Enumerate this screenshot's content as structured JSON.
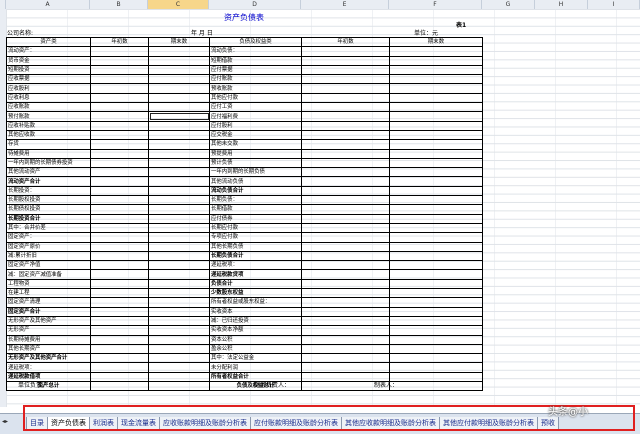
{
  "columns": [
    "A",
    "B",
    "C",
    "D",
    "E",
    "F",
    "G",
    "H",
    "I"
  ],
  "title": "资产负债表",
  "sheet_no": "表1",
  "company_label": "公司名称:",
  "date_label": "年 月 日",
  "unit_label": "单位：元",
  "headers": [
    "资产类",
    "年初数",
    "期末数",
    "负债及权益类",
    "年初数",
    "期末数"
  ],
  "rows": [
    {
      "l": "流动资产：",
      "r": "流动负债："
    },
    {
      "l": "  货币资金",
      "r": "  短期借款"
    },
    {
      "l": "  短期投资",
      "r": "  应付票据"
    },
    {
      "l": "  应收票据",
      "r": "  应付账款"
    },
    {
      "l": "  应收股利",
      "r": "  预收账款"
    },
    {
      "l": "  应收利息",
      "r": "  其他应付款"
    },
    {
      "l": "  应收账款",
      "r": "  应付工资"
    },
    {
      "l": "  预付账款",
      "r": "  应付福利费",
      "sel": true
    },
    {
      "l": "  应收补贴款",
      "r": "  应付股利"
    },
    {
      "l": "  其他应收款",
      "r": "  应交税金"
    },
    {
      "l": "  存货",
      "r": "  其他未交款"
    },
    {
      "l": "  待摊费用",
      "r": "  预提费用"
    },
    {
      "l": "  一年内到期的长期债券投资",
      "r": "  预计负债"
    },
    {
      "l": "  其他流动资产",
      "r": "  一年内到期的长期负债"
    },
    {
      "l": "流动资产合计",
      "r": "  其他流动负债",
      "lb": true
    },
    {
      "l": "长期投资：",
      "r": "流动负债合计",
      "rb": true
    },
    {
      "l": "  长期股权投资",
      "r": "长期负债："
    },
    {
      "l": "  长期债权投资",
      "r": "  长期借款"
    },
    {
      "l": "长期投资合计",
      "r": "  应付债券",
      "lb": true
    },
    {
      "l": "  其中：合并价差",
      "r": "  长期应付款"
    },
    {
      "l": "固定资产：",
      "r": "  专项应付款"
    },
    {
      "l": "  固定资产原价",
      "r": "  其他长期负债"
    },
    {
      "l": "    减:累计折旧",
      "r": "长期负债合计",
      "rb": true
    },
    {
      "l": "固定资产净值",
      "r": "递延税项："
    },
    {
      "l": "  减：固定资产减值准备",
      "r": "  递延税款贷项",
      "rb": true
    },
    {
      "l": "  工程物资",
      "r": "负债合计",
      "rb": true
    },
    {
      "l": "  在建工程",
      "r": "少数股东权益",
      "rb": true
    },
    {
      "l": "  固定资产清理",
      "r": "所有者权益或股东权益："
    },
    {
      "l": "固定资产合计",
      "r": "  实收资本",
      "lb": true
    },
    {
      "l": "无形资产及其他资产",
      "r": "    减：已归还投资"
    },
    {
      "l": "  无形资产",
      "r": "  实收资本净额"
    },
    {
      "l": "  长期待摊费用",
      "r": "  资本公积"
    },
    {
      "l": "  其他长期资产",
      "r": "  盈余公积"
    },
    {
      "l": "无形资产及其他资产合计",
      "r": "    其中：法定公益金",
      "lb": true
    },
    {
      "l": "递延税项：",
      "r": "  未分配利润"
    },
    {
      "l": "  递延税款借项",
      "r": "所有者权益合计",
      "lb": true,
      "rb": true
    },
    {
      "l": "资产总计",
      "r": "负债及权益总计",
      "lb": true,
      "rb": true,
      "center": true
    }
  ],
  "footer": {
    "left": "单位负责人：",
    "mid": "财务负责人：",
    "right": "制表人："
  },
  "tabs": [
    "目录",
    "资产负债表",
    "利润表",
    "现金流量表",
    "应收账款明细及账龄分析表",
    "应付账款明细及账龄分析表",
    "其他应收款明细及账龄分析表",
    "其他应付款明细及账龄分析表",
    "预收"
  ],
  "watermark": "头条@小"
}
